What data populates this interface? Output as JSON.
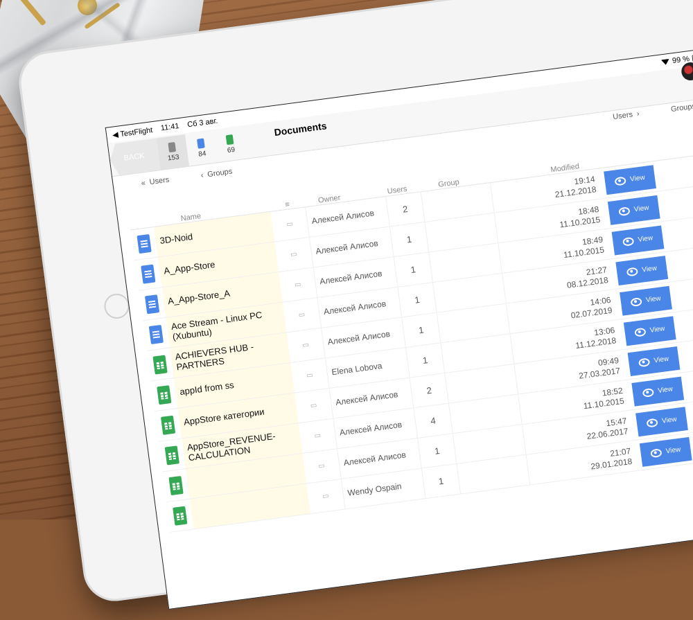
{
  "status": {
    "app": "◀ TestFlight",
    "time": "11:41",
    "date": "Сб 3 авг.",
    "battery": "99 %"
  },
  "header": {
    "back_label": "BACK",
    "title": "Documents",
    "counters": [
      {
        "label": "153",
        "kind": "all"
      },
      {
        "label": "84",
        "kind": "docs"
      },
      {
        "label": "69",
        "kind": "sheets"
      }
    ]
  },
  "breadcrumbs": {
    "top_users": "Users",
    "top_groups": "Groups",
    "left_users": "Users",
    "left_groups": "Groups"
  },
  "columns": {
    "name": "Name",
    "owner": "Owner",
    "users": "Users",
    "group": "Group",
    "modified": "Modified"
  },
  "rows": [
    {
      "icon": "docs",
      "name": "3D-Noid",
      "owner": "Алексей Алисов",
      "users": "2",
      "time": "19:14",
      "date": "21.12.2018"
    },
    {
      "icon": "docs",
      "name": "A_App-Store",
      "owner": "Алексей Алисов",
      "users": "1",
      "time": "18:48",
      "date": "11.10.2015"
    },
    {
      "icon": "docs",
      "name": "A_App-Store_A",
      "owner": "Алексей Алисов",
      "users": "1",
      "time": "18:49",
      "date": "11.10.2015"
    },
    {
      "icon": "docs",
      "name": "Ace Stream - Linux PC (Xubuntu)",
      "owner": "Алексей Алисов",
      "users": "1",
      "time": "21:27",
      "date": "08.12.2018"
    },
    {
      "icon": "sheets",
      "name": "ACHIEVERS HUB - PARTNERS",
      "owner": "Алексей Алисов",
      "users": "1",
      "time": "14:06",
      "date": "02.07.2019"
    },
    {
      "icon": "sheets",
      "name": "appId from ss",
      "owner": "Elena Lobova",
      "users": "1",
      "time": "13:06",
      "date": "11.12.2018"
    },
    {
      "icon": "sheets",
      "name": "AppStore категории",
      "owner": "Алексей Алисов",
      "users": "2",
      "time": "09:49",
      "date": "27.03.2017"
    },
    {
      "icon": "sheets",
      "name": "AppStore_REVENUE-CALCULATION",
      "owner": "Алексей Алисов",
      "users": "4",
      "time": "18:52",
      "date": "11.10.2015"
    },
    {
      "icon": "sheets",
      "name": "",
      "owner": "Алексей Алисов",
      "users": "1",
      "time": "15:47",
      "date": "22.06.2017"
    },
    {
      "icon": "sheets",
      "name": "",
      "owner": "Wendy Ospain",
      "users": "1",
      "time": "21:07",
      "date": "29.01.2018"
    }
  ],
  "view_label": "View",
  "colors": {
    "accent": "#4a86e8",
    "sheets": "#34a853",
    "highlight": "#fffbe6"
  }
}
